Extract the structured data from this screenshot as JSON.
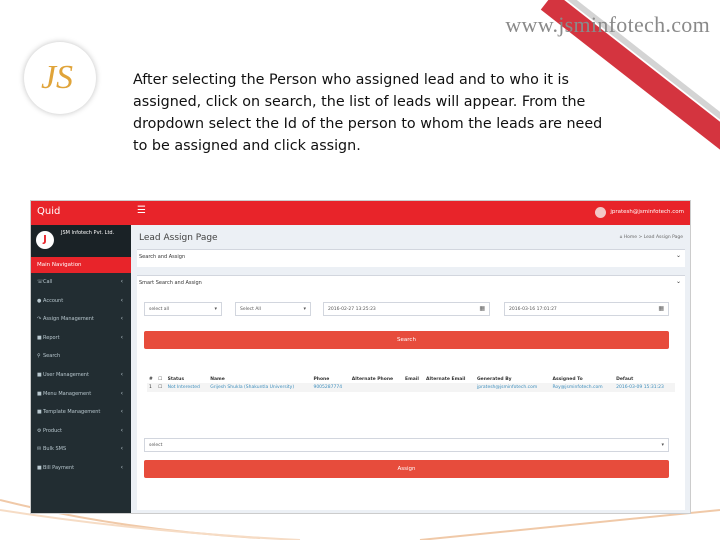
{
  "watermark": "www.jsminfotech.com",
  "logo_text": "JS",
  "caption": "After selecting the Person who assigned lead and to who it is assigned, click on search, the list of leads will appear. From the dropdown select the Id of the person to whom the leads are need to be assigned and click assign.",
  "app": {
    "brand": "Quid",
    "menu_icon": "hamburger-icon",
    "user_email": "jpratesh@jsminfotech.com",
    "accent": "#e8242a"
  },
  "sidebar": {
    "company_badge": "J",
    "company_name": "JSM Infotech Pvt. Ltd.",
    "main_nav": "Main Navigation",
    "items": [
      {
        "label": "Call",
        "icon": "phone-icon"
      },
      {
        "label": "Account",
        "icon": "user-icon"
      },
      {
        "label": "Assign Management",
        "icon": "assign-icon"
      },
      {
        "label": "Report",
        "icon": "folder-icon"
      },
      {
        "label": "Search",
        "icon": "search-icon"
      },
      {
        "label": "User Management",
        "icon": "users-icon"
      },
      {
        "label": "Menu Management",
        "icon": "menu-icon"
      },
      {
        "label": "Template Management",
        "icon": "template-icon"
      },
      {
        "label": "Product",
        "icon": "product-icon"
      },
      {
        "label": "Bulk SMS",
        "icon": "sms-icon"
      },
      {
        "label": "Bill Payment",
        "icon": "bill-icon"
      }
    ]
  },
  "page": {
    "title": "Lead Assign Page",
    "breadcrumb": "⌂ Home  >  Lead Assign Page",
    "box1_title": "Search and Assign",
    "box2_title": "Smart Search and Assign",
    "filter1": "select all",
    "filter2": "Select All",
    "date_from": "2016-02-27 13:25:23",
    "date_to": "2016-03-16 17:01:27",
    "search_label": "Search",
    "table": {
      "headers": [
        "#",
        "",
        "Status",
        "Name",
        "Phone",
        "Alternate Phone",
        "Email",
        "Alternate Email",
        "Generated By",
        "Assigned To",
        "Defaut"
      ],
      "rows": [
        [
          "1",
          "",
          "Not Interested",
          "Grijesh Shukla (Shakuntla University)",
          "9005287774",
          "",
          "",
          "",
          "jpratesh@jsminfotech.com",
          "Roy@jsminfotech.com",
          "2016-03-09 15:31:23"
        ]
      ]
    },
    "assign_select": "select",
    "assign_label": "Assign"
  }
}
